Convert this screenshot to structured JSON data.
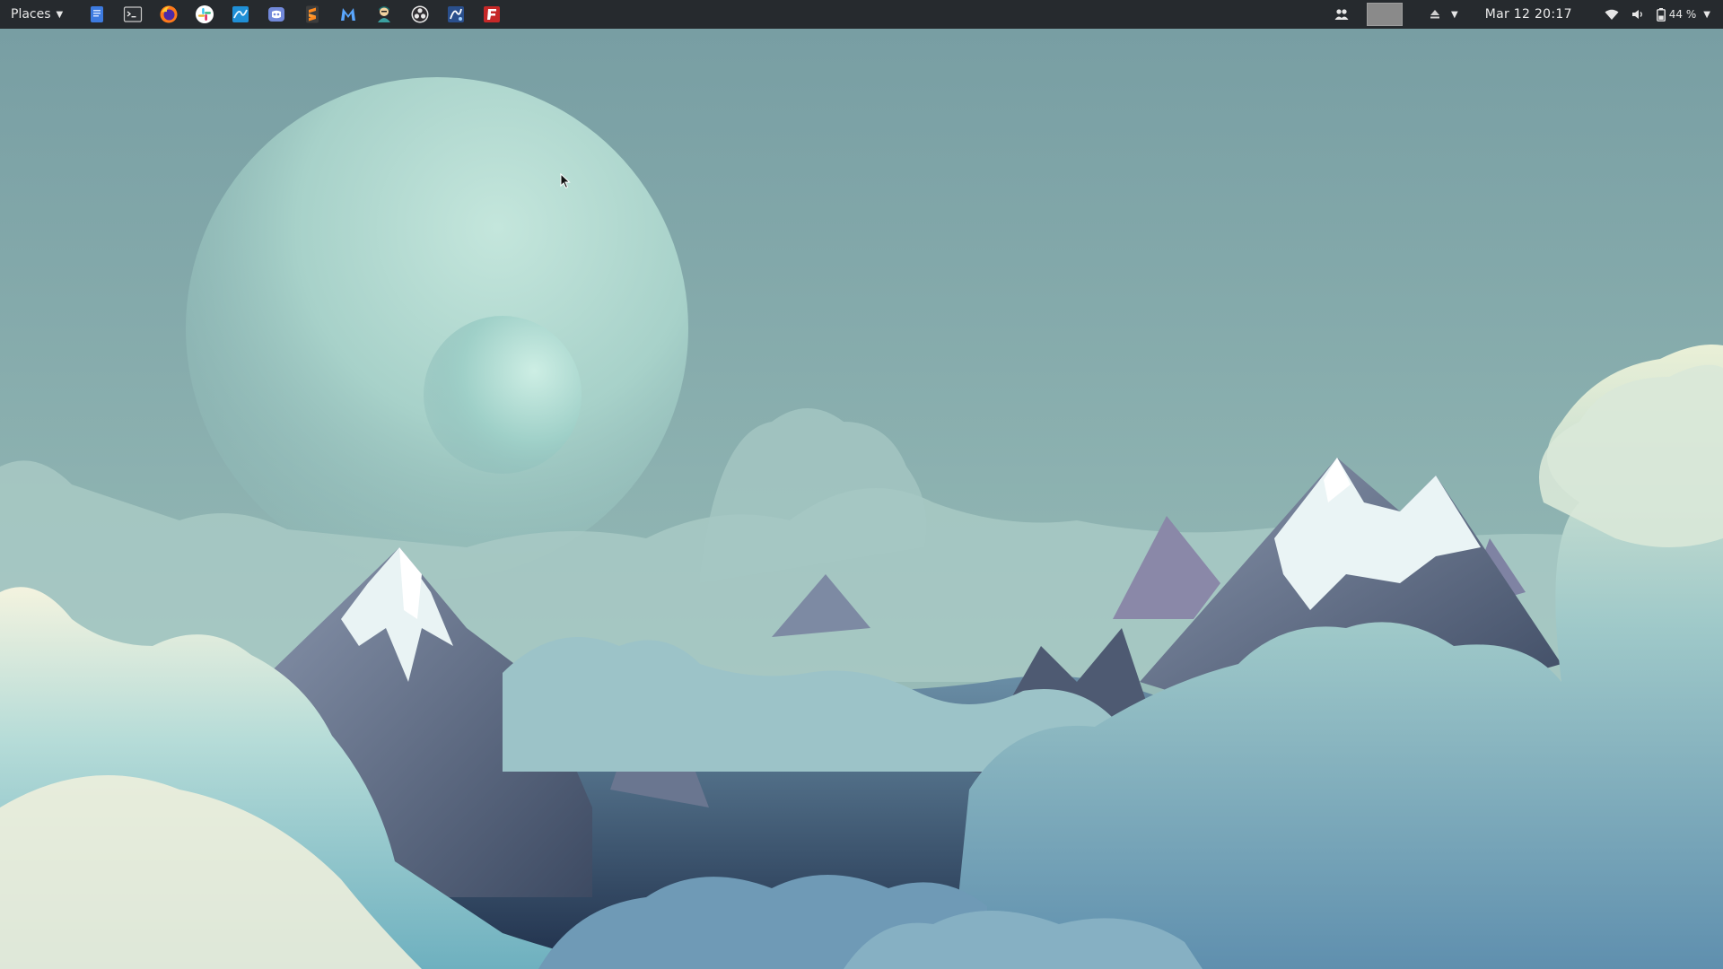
{
  "topbar": {
    "places_label": "Places",
    "launchers": [
      {
        "name": "files-icon",
        "color": "#3d7be0"
      },
      {
        "name": "terminal-icon",
        "color": "#4b4f55"
      },
      {
        "name": "firefox-icon",
        "color": "#ff7a1a"
      },
      {
        "name": "slack-icon",
        "color": "#ffffff"
      },
      {
        "name": "wireshark-icon",
        "color": "#1f8fd6"
      },
      {
        "name": "discord-icon",
        "color": "#7289da"
      },
      {
        "name": "sublime-icon",
        "color": "#ff8a1f"
      },
      {
        "name": "mendeley-icon",
        "color": "#2f6fd6"
      },
      {
        "name": "terminator-icon",
        "color": "#3aa0a0"
      },
      {
        "name": "obs-icon",
        "color": "#e8e8e8"
      },
      {
        "name": "inkscape-icon",
        "color": "#2a4f8c"
      },
      {
        "name": "filezilla-icon",
        "color": "#c62828"
      }
    ],
    "clock": "Mar 12  20:17",
    "battery_label": "44 %"
  },
  "colors": {
    "panel": "#262a2e",
    "sky": "#7c9ea3",
    "planet": "#a7d1c9"
  }
}
